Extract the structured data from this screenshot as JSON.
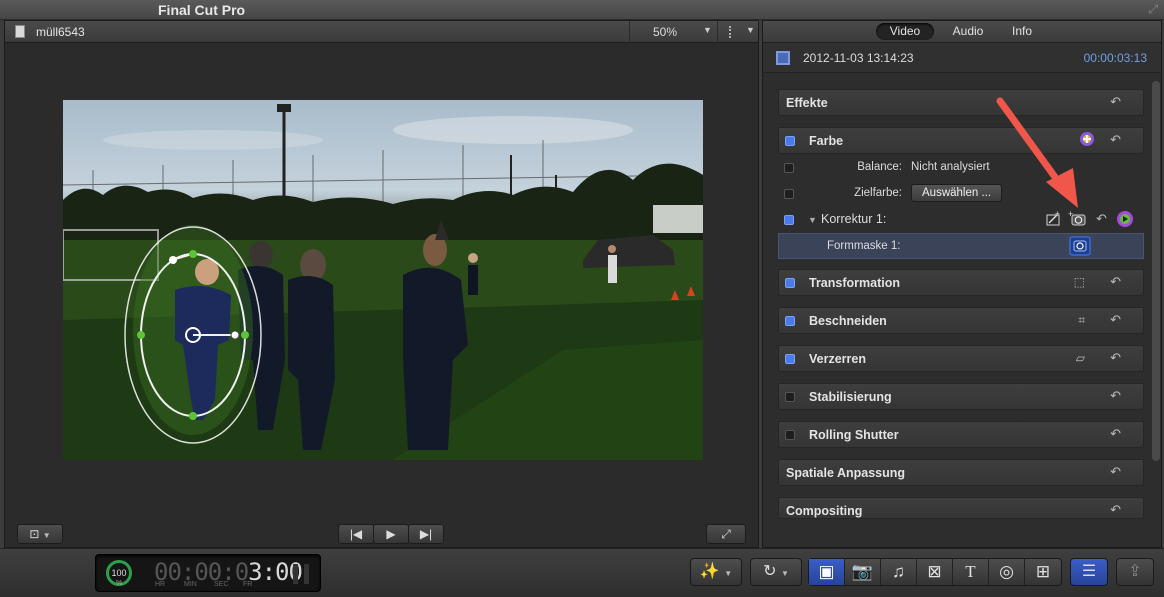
{
  "app": {
    "title": "Final Cut Pro"
  },
  "viewer": {
    "clip_name": "müll6543",
    "zoom": "50%"
  },
  "inspector": {
    "tabs": [
      {
        "label": "Video",
        "active": true
      },
      {
        "label": "Audio",
        "active": false
      },
      {
        "label": "Info",
        "active": false
      }
    ],
    "date": "2012-11-03 13:14:23",
    "timecode": "00:00:03:13",
    "sections": {
      "effekte": "Effekte",
      "farbe": "Farbe",
      "transformation": "Transformation",
      "beschneiden": "Beschneiden",
      "verzerren": "Verzerren",
      "stabilisierung": "Stabilisierung",
      "rolling_shutter": "Rolling Shutter",
      "spatiale": "Spatiale Anpassung",
      "compositing": "Compositing"
    },
    "balance": {
      "label": "Balance:",
      "value": "Nicht analysiert"
    },
    "zielfarbe": {
      "label": "Zielfarbe:",
      "button": "Auswählen ..."
    },
    "korrektur": "Korrektur 1:",
    "formmaske": "Formmaske 1:"
  },
  "dashboard": {
    "progress": "100",
    "progress_unit": "%",
    "timecode_dim": "00:00:0",
    "timecode_bright": "3:00",
    "units": [
      "HR",
      "MIN",
      "SEC",
      "FR"
    ]
  },
  "colors": {
    "accent_blue": "#4b7bea",
    "timecode_blue": "#6f9fe6",
    "annotation_arrow": "#f0574a",
    "mask_green": "#5ec23a"
  }
}
